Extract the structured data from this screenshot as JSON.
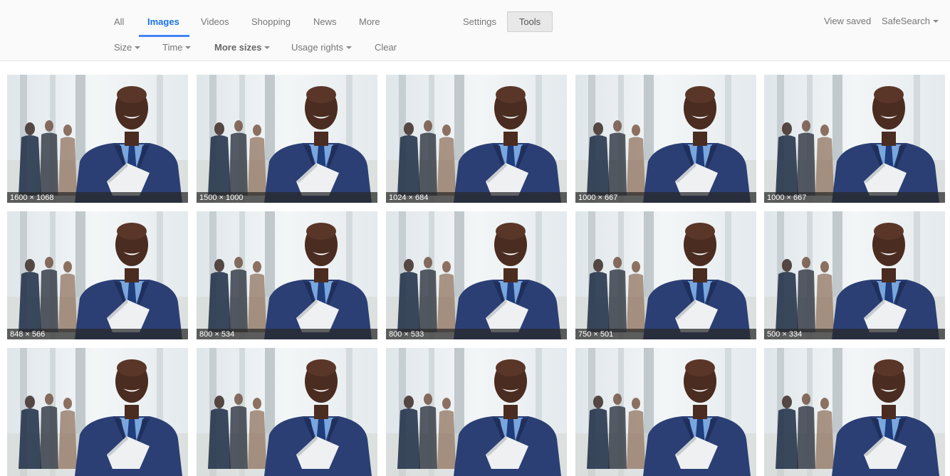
{
  "nav": {
    "tabs": [
      {
        "label": "All"
      },
      {
        "label": "Images",
        "active": true
      },
      {
        "label": "Videos"
      },
      {
        "label": "Shopping"
      },
      {
        "label": "News"
      },
      {
        "label": "More"
      }
    ],
    "settings_label": "Settings",
    "tools_label": "Tools",
    "view_saved_label": "View saved",
    "safesearch_label": "SafeSearch"
  },
  "filters": {
    "size_label": "Size",
    "time_label": "Time",
    "more_sizes_label": "More sizes",
    "usage_rights_label": "Usage rights",
    "clear_label": "Clear"
  },
  "results": [
    {
      "dims": "1600 × 1068"
    },
    {
      "dims": "1500 × 1000"
    },
    {
      "dims": "1024 × 684"
    },
    {
      "dims": "1000 × 667"
    },
    {
      "dims": "1000 × 667"
    },
    {
      "dims": "848 × 566"
    },
    {
      "dims": "800 × 534"
    },
    {
      "dims": "800 × 533"
    },
    {
      "dims": "750 × 501"
    },
    {
      "dims": "500 × 334"
    },
    {
      "dims": ""
    },
    {
      "dims": ""
    },
    {
      "dims": ""
    },
    {
      "dims": ""
    },
    {
      "dims": ""
    }
  ],
  "colors": {
    "accent": "#4285f4",
    "suit": "#2b3f74",
    "shirt": "#7aa6de",
    "tie": "#1f3d7a",
    "skin": "#4a2c20"
  }
}
